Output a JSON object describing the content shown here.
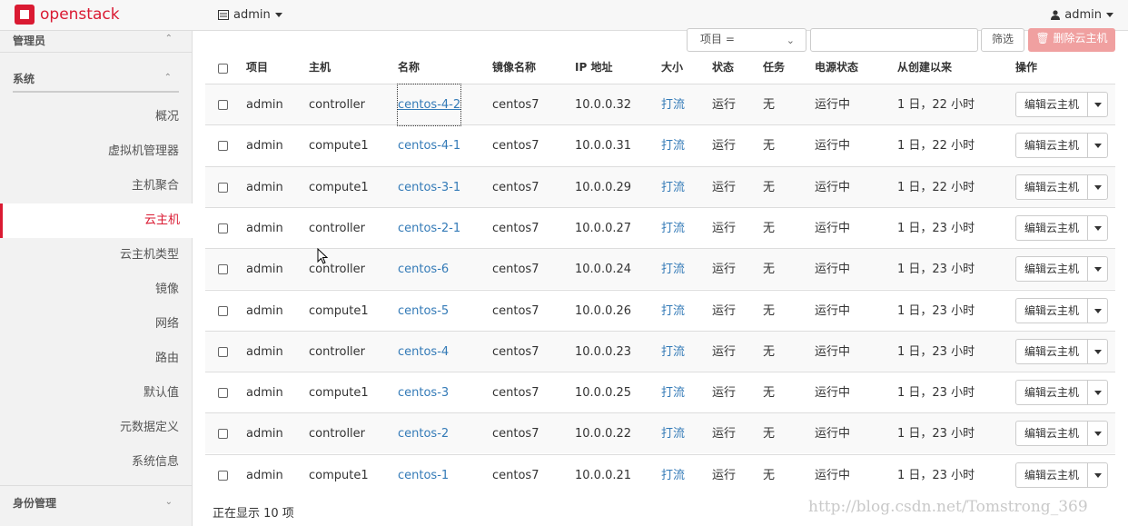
{
  "header": {
    "brand": "openstack",
    "project_label": "admin",
    "user_label": "admin"
  },
  "sidebar": {
    "admin_title": "管理员",
    "system_title": "系统",
    "items": [
      "概况",
      "虚拟机管理器",
      "主机聚合",
      "云主机",
      "云主机类型",
      "镜像",
      "网络",
      "路由",
      "默认值",
      "元数据定义",
      "系统信息"
    ],
    "active_index": 3,
    "identity_title": "身份管理"
  },
  "filter": {
    "select_label": "项目 =",
    "filter_button": "筛选",
    "delete_button": "删除云主机"
  },
  "table": {
    "columns": [
      "项目",
      "主机",
      "名称",
      "镜像名称",
      "IP 地址",
      "大小",
      "状态",
      "任务",
      "电源状态",
      "从创建以来",
      "操作"
    ],
    "rows": [
      {
        "project": "admin",
        "host": "controller",
        "name": "centos-4-2",
        "image": "centos7",
        "ip": "10.0.0.32",
        "size": "打流",
        "status": "运行",
        "task": "无",
        "power": "运行中",
        "age": "1 日，22 小时",
        "action": "编辑云主机"
      },
      {
        "project": "admin",
        "host": "compute1",
        "name": "centos-4-1",
        "image": "centos7",
        "ip": "10.0.0.31",
        "size": "打流",
        "status": "运行",
        "task": "无",
        "power": "运行中",
        "age": "1 日，22 小时",
        "action": "编辑云主机"
      },
      {
        "project": "admin",
        "host": "compute1",
        "name": "centos-3-1",
        "image": "centos7",
        "ip": "10.0.0.29",
        "size": "打流",
        "status": "运行",
        "task": "无",
        "power": "运行中",
        "age": "1 日，22 小时",
        "action": "编辑云主机"
      },
      {
        "project": "admin",
        "host": "controller",
        "name": "centos-2-1",
        "image": "centos7",
        "ip": "10.0.0.27",
        "size": "打流",
        "status": "运行",
        "task": "无",
        "power": "运行中",
        "age": "1 日，23 小时",
        "action": "编辑云主机"
      },
      {
        "project": "admin",
        "host": "controller",
        "name": "centos-6",
        "image": "centos7",
        "ip": "10.0.0.24",
        "size": "打流",
        "status": "运行",
        "task": "无",
        "power": "运行中",
        "age": "1 日，23 小时",
        "action": "编辑云主机"
      },
      {
        "project": "admin",
        "host": "compute1",
        "name": "centos-5",
        "image": "centos7",
        "ip": "10.0.0.26",
        "size": "打流",
        "status": "运行",
        "task": "无",
        "power": "运行中",
        "age": "1 日，23 小时",
        "action": "编辑云主机"
      },
      {
        "project": "admin",
        "host": "controller",
        "name": "centos-4",
        "image": "centos7",
        "ip": "10.0.0.23",
        "size": "打流",
        "status": "运行",
        "task": "无",
        "power": "运行中",
        "age": "1 日，23 小时",
        "action": "编辑云主机"
      },
      {
        "project": "admin",
        "host": "compute1",
        "name": "centos-3",
        "image": "centos7",
        "ip": "10.0.0.25",
        "size": "打流",
        "status": "运行",
        "task": "无",
        "power": "运行中",
        "age": "1 日，23 小时",
        "action": "编辑云主机"
      },
      {
        "project": "admin",
        "host": "controller",
        "name": "centos-2",
        "image": "centos7",
        "ip": "10.0.0.22",
        "size": "打流",
        "status": "运行",
        "task": "无",
        "power": "运行中",
        "age": "1 日，23 小时",
        "action": "编辑云主机"
      },
      {
        "project": "admin",
        "host": "compute1",
        "name": "centos-1",
        "image": "centos7",
        "ip": "10.0.0.21",
        "size": "打流",
        "status": "运行",
        "task": "无",
        "power": "运行中",
        "age": "1 日，23 小时",
        "action": "编辑云主机"
      }
    ],
    "footer": "正在显示 10 项"
  },
  "watermark": "http://blog.csdn.net/Tomstrong_369",
  "colors": {
    "brand": "#da1a32",
    "link": "#337ab7",
    "danger_button": "#f0a0a0"
  }
}
